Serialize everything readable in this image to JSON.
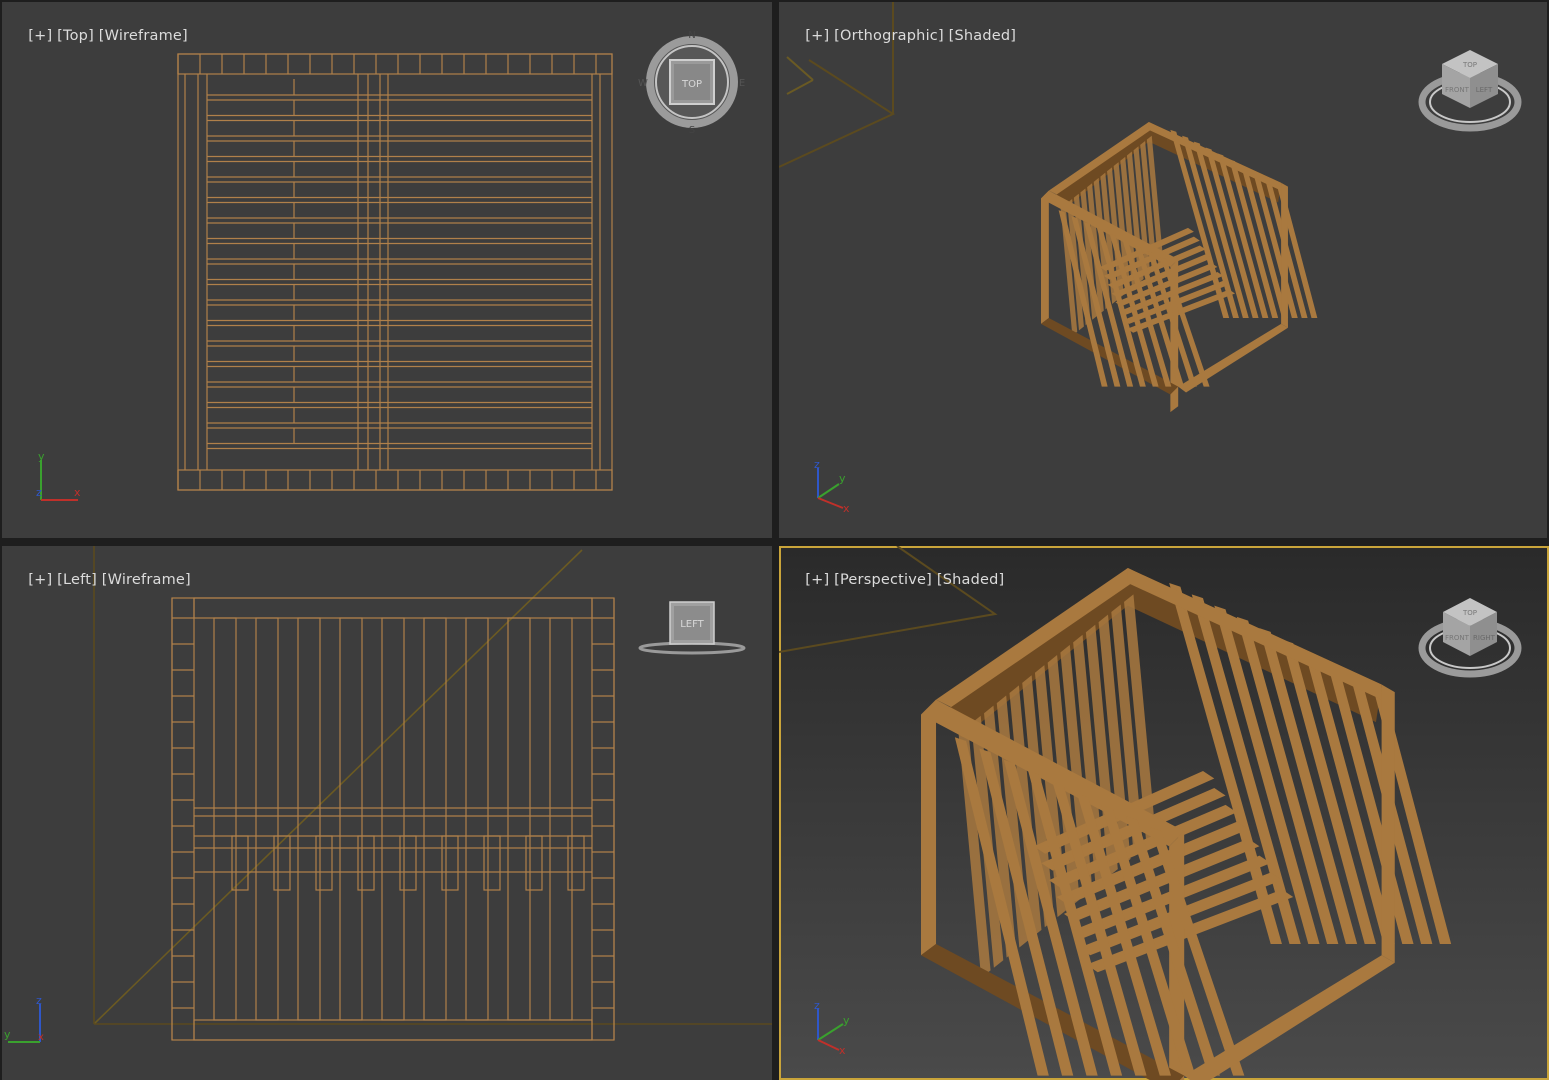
{
  "viewports": {
    "top": {
      "menu": "[+]",
      "view": "[Top]",
      "mode": "[Wireframe]",
      "viewcube_face": "TOP",
      "compass": {
        "n": "N",
        "s": "S",
        "w": "W",
        "e": "E"
      },
      "axes": {
        "a": "y",
        "b": "z",
        "c": "x"
      }
    },
    "orthographic": {
      "menu": "[+]",
      "view": "[Orthographic]",
      "mode": "[Shaded]",
      "viewcube_faces": [
        "TOP",
        "FRONT",
        "LEFT"
      ],
      "axes": {
        "a": "z",
        "b": "y",
        "c": "x"
      }
    },
    "left": {
      "menu": "[+]",
      "view": "[Left]",
      "mode": "[Wireframe]",
      "viewcube_face": "LEFT",
      "axes": {
        "a": "z",
        "b": "y",
        "c": "x"
      }
    },
    "perspective": {
      "menu": "[+]",
      "view": "[Perspective]",
      "mode": "[Shaded]",
      "active": true,
      "viewcube_faces": [
        "TOP",
        "FRONT",
        "RIGHT"
      ],
      "axes": {
        "a": "z",
        "b": "y",
        "c": "x"
      }
    }
  },
  "colors": {
    "viewport_bg": "#3d3d3d",
    "active_border": "#c9a43a",
    "wire": "#b0804a",
    "wood_light": "#a9793f",
    "wood_dark": "#6e4a22",
    "axis_x": "#c0302a",
    "axis_y": "#3aa12e",
    "axis_z": "#2f57c9"
  },
  "icons": [
    "viewcube-icon",
    "compass-ring-icon",
    "axis-tripod-icon"
  ]
}
